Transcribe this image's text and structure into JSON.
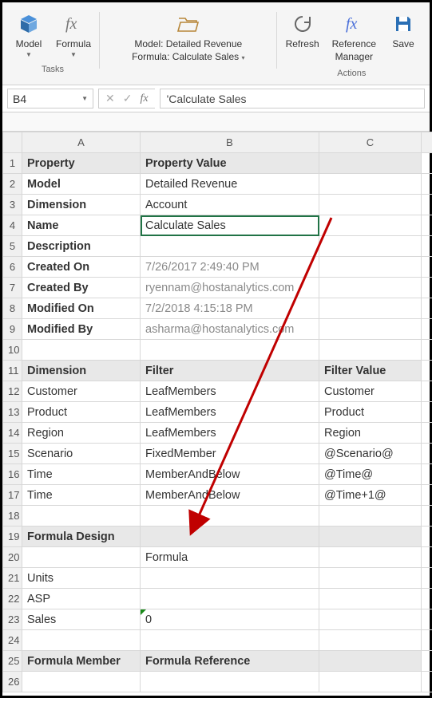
{
  "ribbon": {
    "groups": {
      "tasks": {
        "label": "Tasks"
      },
      "actions": {
        "label": "Actions"
      }
    },
    "buttons": {
      "model": "Model",
      "formula": "Formula",
      "modelFormula_line1": "Model: Detailed Revenue",
      "modelFormula_line2": "Formula: Calculate Sales",
      "refresh": "Refresh",
      "refmgr_line1": "Reference",
      "refmgr_line2": "Manager",
      "save": "Save"
    }
  },
  "colors": {
    "cube": "#4a90d9",
    "fx": "#888",
    "folder": "#d9a24a",
    "refresh": "#666",
    "reffx": "#4a6fd9",
    "save": "#2a6fb5"
  },
  "formulaBar": {
    "cellRef": "B4",
    "value": "'Calculate Sales"
  },
  "columns": [
    "A",
    "B",
    "C"
  ],
  "rows": [
    {
      "n": 1,
      "a": "Property",
      "b": "Property Value",
      "c": "",
      "hdr": true
    },
    {
      "n": 2,
      "a": "Model",
      "b": "Detailed Revenue",
      "c": ""
    },
    {
      "n": 3,
      "a": "Dimension",
      "b": "Account",
      "c": ""
    },
    {
      "n": 4,
      "a": "Name",
      "b": "Calculate Sales",
      "c": "",
      "sel": true
    },
    {
      "n": 5,
      "a": "Description",
      "b": "",
      "c": ""
    },
    {
      "n": 6,
      "a": "Created On",
      "b": "7/26/2017 2:49:40 PM",
      "c": "",
      "grey": true
    },
    {
      "n": 7,
      "a": "Created By",
      "b": "ryennam@hostanalytics.com",
      "c": "",
      "grey": true
    },
    {
      "n": 8,
      "a": "Modified On",
      "b": "7/2/2018 4:15:18 PM",
      "c": "",
      "grey": true
    },
    {
      "n": 9,
      "a": "Modified By",
      "b": "asharma@hostanalytics.com",
      "c": "",
      "grey": true
    },
    {
      "n": 10,
      "a": "",
      "b": "",
      "c": ""
    },
    {
      "n": 11,
      "a": "Dimension",
      "b": "Filter",
      "c": "Filter Value",
      "hdr": true
    },
    {
      "n": 12,
      "a": "Customer",
      "b": "LeafMembers",
      "c": "Customer"
    },
    {
      "n": 13,
      "a": "Product",
      "b": "LeafMembers",
      "c": "Product"
    },
    {
      "n": 14,
      "a": "Region",
      "b": "LeafMembers",
      "c": "Region"
    },
    {
      "n": 15,
      "a": "Scenario",
      "b": "FixedMember",
      "c": "@Scenario@"
    },
    {
      "n": 16,
      "a": "Time",
      "b": "MemberAndBelow",
      "c": "@Time@"
    },
    {
      "n": 17,
      "a": "Time",
      "b": "MemberAndBelow",
      "c": "@Time+1@"
    },
    {
      "n": 18,
      "a": "",
      "b": "",
      "c": ""
    },
    {
      "n": 19,
      "a": "Formula Design",
      "b": "",
      "c": "",
      "hdr": true
    },
    {
      "n": 20,
      "a": "",
      "b": "Formula",
      "c": ""
    },
    {
      "n": 21,
      "a": "Units",
      "b": "",
      "c": ""
    },
    {
      "n": 22,
      "a": "ASP",
      "b": "",
      "c": ""
    },
    {
      "n": 23,
      "a": "Sales",
      "b": "0",
      "c": "",
      "bRight": true,
      "tri": true
    },
    {
      "n": 24,
      "a": "",
      "b": "",
      "c": ""
    },
    {
      "n": 25,
      "a": "Formula Member",
      "b": "Formula Reference",
      "c": "",
      "hdr": true
    },
    {
      "n": 26,
      "a": "",
      "b": "",
      "c": ""
    }
  ]
}
